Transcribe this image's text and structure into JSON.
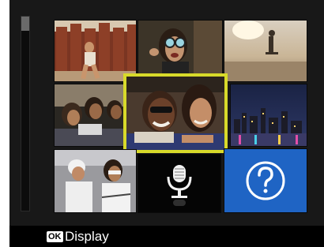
{
  "bottom_bar": {
    "ok_key": "OK",
    "action_label": "Display"
  },
  "grid": {
    "tiles": [
      {
        "name": "photo-wooden-fence"
      },
      {
        "name": "photo-woman-sunglasses"
      },
      {
        "name": "photo-skateboarder-sunset"
      },
      {
        "name": "photo-three-friends"
      },
      {
        "name": "photo-city-skyline-night"
      },
      {
        "name": "photo-friends-white-clothes"
      },
      {
        "name": "voice-memo",
        "icon": "microphone-icon"
      },
      {
        "name": "help",
        "icon": "question-mark-icon"
      }
    ],
    "selected": {
      "name": "photo-couple-smiling"
    }
  },
  "colors": {
    "selection_border": "#d8da2a",
    "help_tile": "#1f64c4",
    "background": "#181818"
  }
}
